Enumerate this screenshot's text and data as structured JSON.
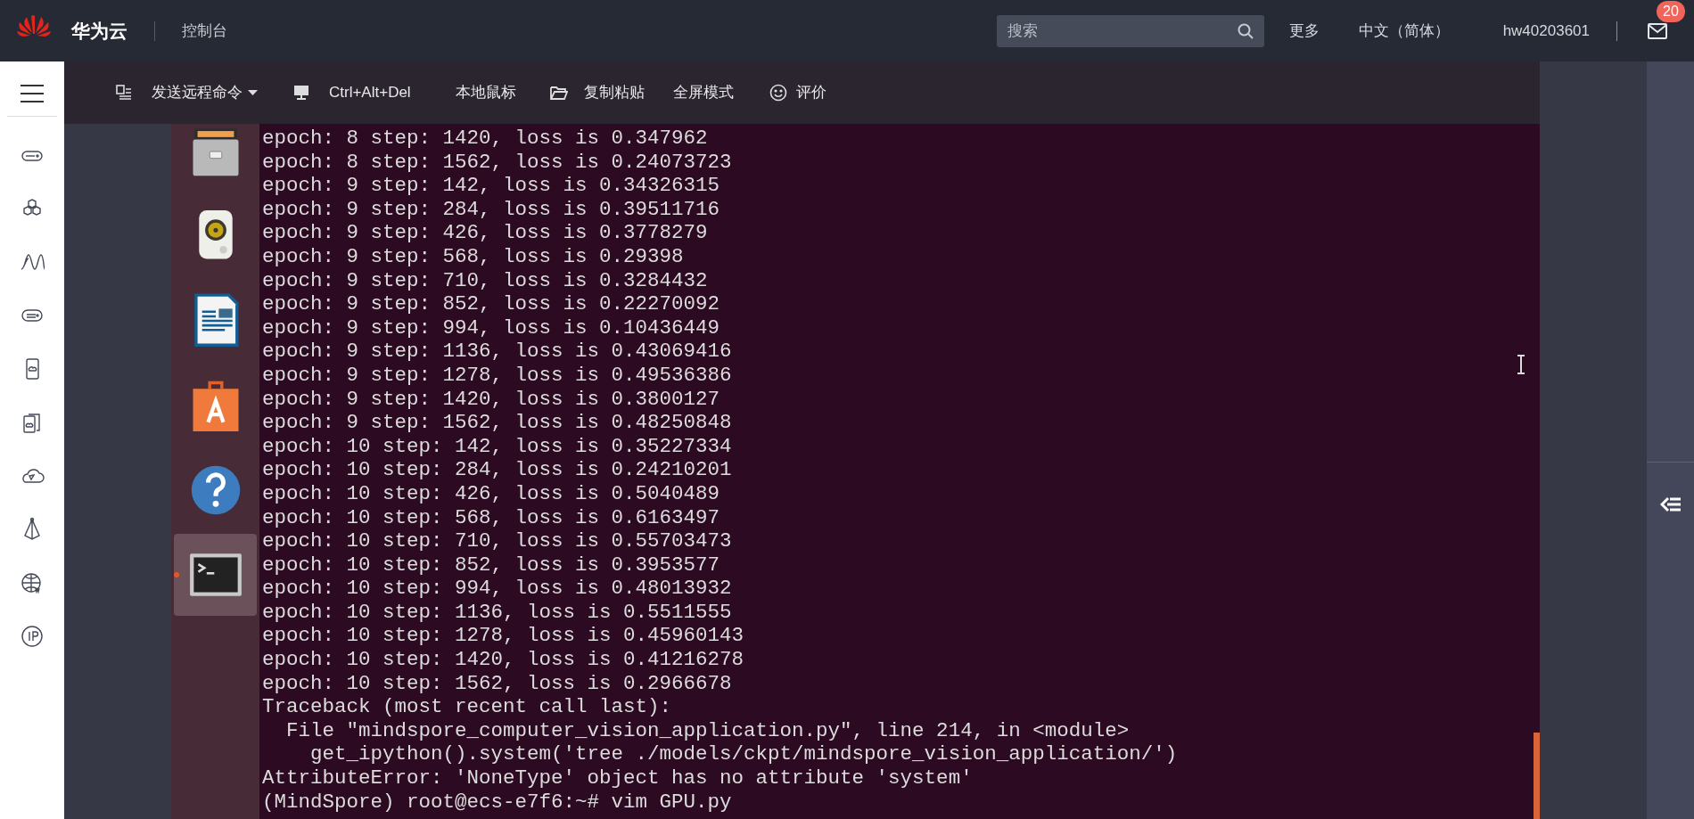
{
  "topbar": {
    "brand": "华为云",
    "section": "控制台",
    "search": {
      "placeholder": "搜索"
    },
    "links": [
      "更多",
      "中文（简体）",
      "hw40203601"
    ],
    "notifications": "20"
  },
  "toolbar": [
    {
      "label": "发送远程命令",
      "dropdown": true
    },
    {
      "label": "Ctrl+Alt+Del",
      "dropdown": false
    },
    {
      "label": "本地鼠标",
      "dropdown": false
    },
    {
      "label": "复制粘贴",
      "dropdown": false
    },
    {
      "label": "全屏模式",
      "dropdown": false
    },
    {
      "label": "评价",
      "dropdown": false
    }
  ],
  "launcher": [
    {
      "kind": "files",
      "selected": false
    },
    {
      "kind": "speaker",
      "selected": false
    },
    {
      "kind": "writer",
      "selected": false
    },
    {
      "kind": "store",
      "selected": false
    },
    {
      "kind": "help",
      "selected": false
    },
    {
      "kind": "terminal",
      "selected": true
    }
  ],
  "terminal": {
    "lines": [
      "epoch: 8 step: 1420, loss is 0.347962",
      "epoch: 8 step: 1562, loss is 0.24073723",
      "epoch: 9 step: 142, loss is 0.34326315",
      "epoch: 9 step: 284, loss is 0.39511716",
      "epoch: 9 step: 426, loss is 0.3778279",
      "epoch: 9 step: 568, loss is 0.29398",
      "epoch: 9 step: 710, loss is 0.3284432",
      "epoch: 9 step: 852, loss is 0.22270092",
      "epoch: 9 step: 994, loss is 0.10436449",
      "epoch: 9 step: 1136, loss is 0.43069416",
      "epoch: 9 step: 1278, loss is 0.49536386",
      "epoch: 9 step: 1420, loss is 0.3800127",
      "epoch: 9 step: 1562, loss is 0.48250848",
      "epoch: 10 step: 142, loss is 0.35227334",
      "epoch: 10 step: 284, loss is 0.24210201",
      "epoch: 10 step: 426, loss is 0.5040489",
      "epoch: 10 step: 568, loss is 0.6163497",
      "epoch: 10 step: 710, loss is 0.55703473",
      "epoch: 10 step: 852, loss is 0.3953577",
      "epoch: 10 step: 994, loss is 0.48013932",
      "epoch: 10 step: 1136, loss is 0.5511555",
      "epoch: 10 step: 1278, loss is 0.45960143",
      "epoch: 10 step: 1420, loss is 0.41216278",
      "epoch: 10 step: 1562, loss is 0.2966678",
      "Traceback (most recent call last):",
      "  File \"mindspore_computer_vision_application.py\", line 214, in <module>",
      "    get_ipython().system('tree ./models/ckpt/mindspore_vision_application/')",
      "AttributeError: 'NoneType' object has no attribute 'system'",
      "(MindSpore) root@ecs-e7f6:~# vim GPU.py"
    ]
  }
}
